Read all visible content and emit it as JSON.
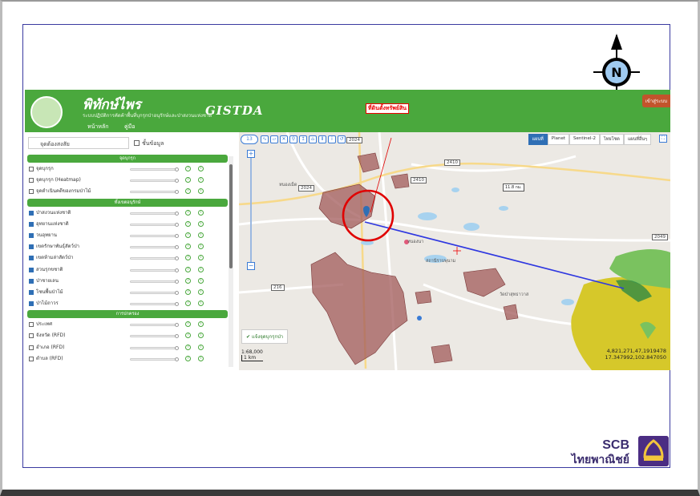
{
  "header": {
    "title": "พิทักษ์ไพร",
    "subtitle": "ระบบปฏิบัติการคัดค้าพื้นที่บุกรุกป่าอนุรักษ์และป่าสงวนแห่งชาติ",
    "brand": "GISTDA",
    "tabs": [
      "หน้าหลัก",
      "คู่มือ"
    ],
    "login": "เข้าสู่ระบบ"
  },
  "sidebar": {
    "search_placeholder": "จุดต้องสงสัย",
    "info_label": "ชั้นข้อมูล",
    "groups": [
      {
        "title": "จุดบุกรุก",
        "items": [
          {
            "label": "จุดบุกรุก",
            "checked": false
          },
          {
            "label": "จุดบุกรุก (Heatmap)",
            "checked": false
          },
          {
            "label": "จุดดำเนินคดีของกรมป่าไม้",
            "checked": false
          }
        ]
      },
      {
        "title": "ทั้งเขตอนุรักษ์",
        "items": [
          {
            "label": "ป่าสงวนแห่งชาติ",
            "checked": true
          },
          {
            "label": "อุทยานแห่งชาติ",
            "checked": true
          },
          {
            "label": "วนอุทยาน",
            "checked": true
          },
          {
            "label": "เขตรักษาพันธุ์สัตว์ป่า",
            "checked": true
          },
          {
            "label": "เขตห้ามล่าสัตว์ป่า",
            "checked": true
          },
          {
            "label": "สวนรุกขชาติ",
            "checked": true
          },
          {
            "label": "ป่าชายเลน",
            "checked": true
          },
          {
            "label": "โซนพื้นป่าไม้",
            "checked": true
          },
          {
            "label": "ป่าไม้ถาวร",
            "checked": true
          }
        ]
      },
      {
        "title": "การปกครอง",
        "items": [
          {
            "label": "ประเทศ",
            "checked": false
          },
          {
            "label": "จังหวัด (RFD)",
            "checked": false
          },
          {
            "label": "อำเภอ (RFD)",
            "checked": false
          },
          {
            "label": "ตำบล (RFD)",
            "checked": false
          }
        ]
      }
    ]
  },
  "map": {
    "basemaps": [
      "แผนที่",
      "Planet",
      "Sentinel-2",
      "ไทยโชต",
      "แผนที่อื่นๆ"
    ],
    "selected_basemap": "แผนที่",
    "zoom_level": "13",
    "callout": "ที่ดินตั้งทรัพย์สิน",
    "distance": "11.8 กม.",
    "legend_button": "แจ้งจุดบุกรุกป่า",
    "scale": [
      "1:68,000",
      "1 km"
    ],
    "coords": [
      "4,821,271,47,1919478",
      "17.347992,102.847050"
    ],
    "place_labels": [
      "หนองเม็ด",
      "หนองนา",
      "สถานีราบพุนาม",
      "วัดป่าสุทธาวาส"
    ],
    "road_labels": [
      "2024",
      "2410",
      "2410",
      "2049",
      "216",
      "2024"
    ],
    "colors": {
      "route": "#2e37e0",
      "reserve": "#a25a5a",
      "park": "#d6c82a",
      "sanctuary": "#7ac25f",
      "circle": "#e00000"
    }
  },
  "compass": {
    "letter": "N"
  },
  "bank": {
    "line1": "SCB",
    "line2": "ไทยพาณิชย์"
  }
}
